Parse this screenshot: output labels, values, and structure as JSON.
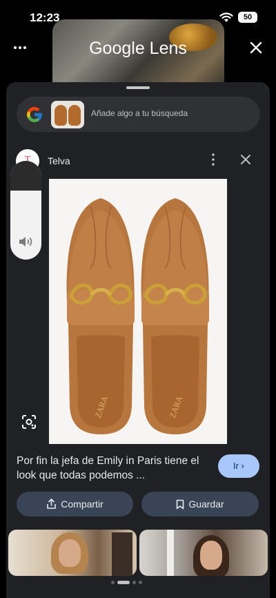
{
  "status_bar": {
    "time": "12:23",
    "battery": "50"
  },
  "header": {
    "title": "Google Lens"
  },
  "search": {
    "placeholder": "Añade algo a tu búsqueda"
  },
  "source": {
    "avatar_letter": "T",
    "name": "Telva"
  },
  "result": {
    "image_brand_left": "ZARA",
    "image_brand_right": "ZARA",
    "caption": "Por fin la jefa de Emily in Paris tiene el look que todas podemos ...",
    "go_label": "Ir",
    "share_label": "Compartir",
    "save_label": "Guardar"
  },
  "volume": {
    "level": 0.7
  },
  "pagination": {
    "total": 4,
    "active": 2
  },
  "colors": {
    "sheet": "#202124",
    "accent_button": "#a8c7fa",
    "action_button": "#394457"
  },
  "icons": [
    "wifi-icon",
    "more-icon",
    "close-icon",
    "google-g-icon",
    "kebab-icon",
    "speaker-icon",
    "lens-scan-icon",
    "share-icon",
    "bookmark-icon",
    "chevron-right-icon"
  ]
}
